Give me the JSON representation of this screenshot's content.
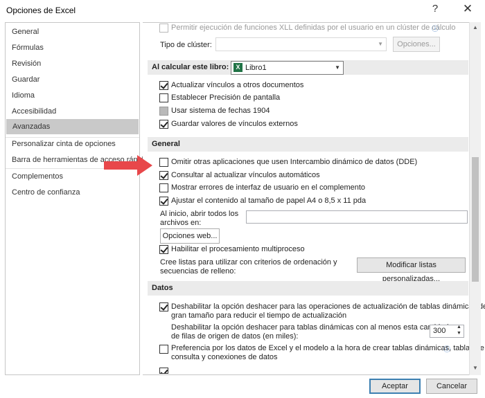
{
  "window": {
    "title": "Opciones de Excel",
    "help": "?",
    "close": "✕"
  },
  "nav": {
    "items": [
      {
        "label": "General"
      },
      {
        "label": "Fórmulas"
      },
      {
        "label": "Revisión"
      },
      {
        "label": "Guardar"
      },
      {
        "label": "Idioma"
      },
      {
        "label": "Accesibilidad"
      },
      {
        "label": "Avanzadas"
      },
      {
        "label": "Personalizar cinta de opciones"
      },
      {
        "label": "Barra de herramientas de acceso rápido"
      },
      {
        "label": "Complementos"
      },
      {
        "label": "Centro de confianza"
      }
    ],
    "selected": "Avanzadas"
  },
  "content": {
    "xll_label": "Permitir ejecución de funciones XLL definidas por el usuario en un clúster de cálculo",
    "cluster_type_label": "Tipo de clúster:",
    "cluster_type_value": "",
    "options_button": "Opciones...",
    "calc_section": {
      "header": "Al calcular este libro:",
      "workbook_value": "Libro1",
      "items": [
        {
          "label": "Actualizar vínculos a otros documentos",
          "checked": true
        },
        {
          "label": "Establecer Precisión de pantalla",
          "checked": false
        },
        {
          "label": "Usar sistema de fechas 1904",
          "checked": false,
          "gray": true
        },
        {
          "label": "Guardar valores de vínculos externos",
          "checked": true
        }
      ]
    },
    "general_section": {
      "header": "General",
      "items": [
        {
          "label": "Omitir otras aplicaciones que usen Intercambio dinámico de datos (DDE)",
          "checked": false
        },
        {
          "label": "Consultar al actualizar vínculos automáticos",
          "checked": true
        },
        {
          "label": "Mostrar errores de interfaz de usuario en el complemento",
          "checked": false
        },
        {
          "label": "Ajustar el contenido al tamaño de papel A4 o 8,5 x 11 pda",
          "checked": true
        }
      ],
      "startup_label_1": "Al inicio, abrir todos los",
      "startup_label_2": "archivos en:",
      "startup_value": "",
      "web_options_button": "Opciones web...",
      "multiprocess_label": "Habilitar el procesamiento multiproceso",
      "multiprocess_checked": true,
      "custom_lists_label_1": "Cree listas para utilizar con criterios de ordenación y",
      "custom_lists_label_2": "secuencias de relleno:",
      "custom_lists_button": "Modificar listas personalizadas..."
    },
    "data_section": {
      "header": "Datos",
      "undo_large_label_1": "Deshabilitar la opción deshacer para las operaciones de actualización de tablas dinámicas de",
      "undo_large_label_2": "gran tamaño para reducir el tiempo de actualización",
      "undo_large_checked": true,
      "undo_rows_label_1": "Deshabilitar la opción deshacer para tablas dinámicas con al menos esta cantidad",
      "undo_rows_label_2": "de filas de origen de datos (en miles):",
      "undo_rows_value": "300",
      "pref_label_1": "Preferencia por los datos de Excel y el modelo a la hora de crear tablas dinámicas, tablas de",
      "pref_label_2": "consulta y conexiones de datos",
      "pref_checked": false
    }
  },
  "footer": {
    "accept": "Aceptar",
    "cancel": "Cancelar"
  },
  "colors": {
    "accent_arrow": "#e8474a",
    "excel_green": "#217346"
  }
}
